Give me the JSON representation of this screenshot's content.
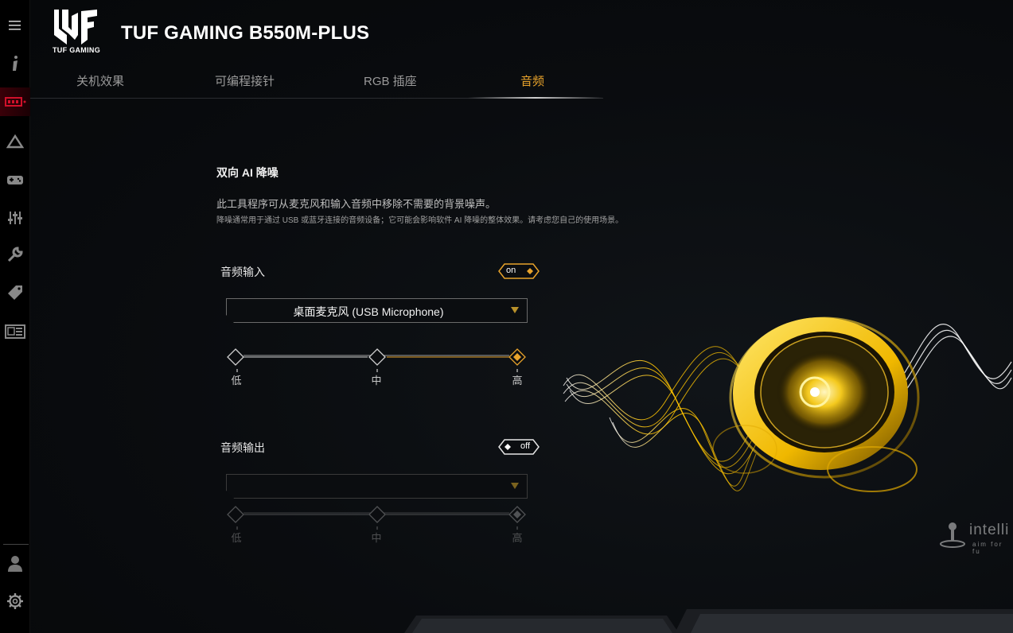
{
  "app": {
    "logo_text": "TUF GAMING",
    "title": "TUF GAMING B550M-PLUS"
  },
  "sidebar": {
    "items": [
      {
        "icon": "menu-icon"
      },
      {
        "icon": "info-icon"
      },
      {
        "icon": "motherboard-icon",
        "active": true
      },
      {
        "icon": "aura-icon"
      },
      {
        "icon": "gamepad-icon"
      },
      {
        "icon": "equalizer-icon"
      },
      {
        "icon": "wrench-icon"
      },
      {
        "icon": "tag-icon"
      },
      {
        "icon": "news-icon"
      },
      {
        "icon": "user-icon"
      },
      {
        "icon": "gear-icon"
      }
    ]
  },
  "tabs": [
    {
      "label": "关机效果"
    },
    {
      "label": "可编程接针"
    },
    {
      "label": "RGB 插座"
    },
    {
      "label": "音频",
      "active": true
    }
  ],
  "noise_cancel": {
    "title": "双向 AI 降噪",
    "description": "此工具程序可从麦克风和输入音频中移除不需要的背景噪声。",
    "note": "降噪通常用于通过 USB 或蓝牙连接的音频设备；它可能会影响软件 AI 降噪的整体效果。请考虑您自己的使用场景。"
  },
  "audio_input": {
    "label": "音频输入",
    "toggle": "on",
    "device": "桌面麦克风 (USB Microphone)",
    "levels": [
      "低",
      "中",
      "高"
    ],
    "selected_level": "高"
  },
  "audio_output": {
    "label": "音频输出",
    "toggle": "off",
    "device": "",
    "levels": [
      "低",
      "中",
      "高"
    ],
    "selected_level": "高"
  },
  "watermark": {
    "text": "intelli",
    "sub": "aim for fu"
  },
  "colors": {
    "accent": "#e8a32b",
    "brand_red": "#c8102e",
    "background": "#0a0c0f"
  }
}
